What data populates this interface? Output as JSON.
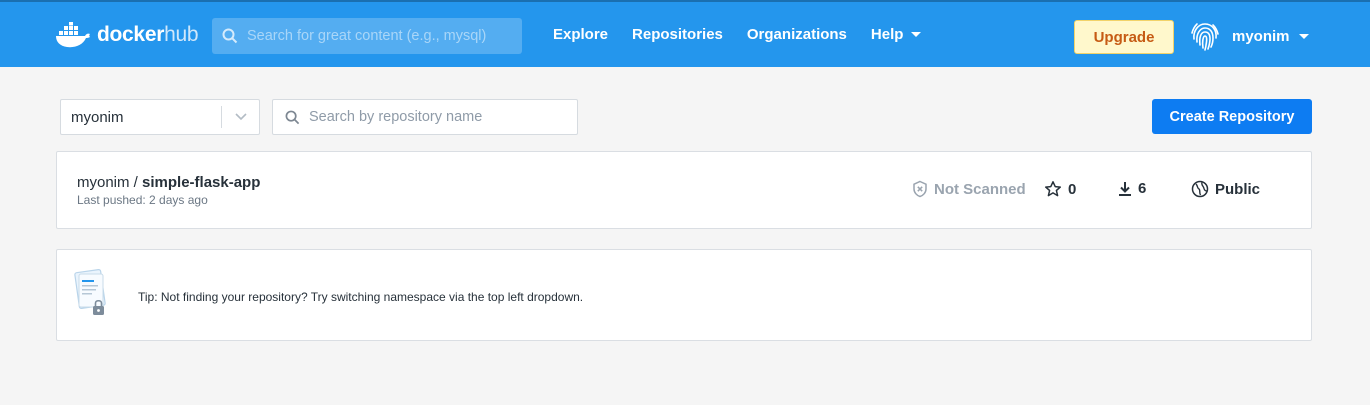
{
  "header": {
    "logo_text_bold": "docker",
    "logo_text_light": "hub",
    "search_placeholder": "Search for great content (e.g., mysql)",
    "nav": [
      {
        "label": "Explore"
      },
      {
        "label": "Repositories"
      },
      {
        "label": "Organizations"
      },
      {
        "label": "Help",
        "has_caret": true
      }
    ],
    "upgrade_label": "Upgrade",
    "username": "myonim"
  },
  "toolbar": {
    "namespace_value": "myonim",
    "repo_search_placeholder": "Search by repository name",
    "create_label": "Create Repository"
  },
  "repositories": [
    {
      "namespace": "myonim /",
      "name": "simple-flask-app",
      "last_pushed": "Last pushed: 2 days ago",
      "scan_status": "Not Scanned",
      "stars": "0",
      "pulls": "6",
      "visibility": "Public"
    }
  ],
  "tip": {
    "text": "Tip: Not finding your repository? Try switching namespace via the top left dropdown."
  },
  "colors": {
    "brand": "#2496ed",
    "primary_button": "#0d7cf2",
    "upgrade_bg": "#fff8cc",
    "upgrade_text": "#c65b14"
  },
  "icons": [
    "docker-whale-icon",
    "search-icon",
    "caret-down-icon",
    "fingerprint-avatar-icon",
    "chevron-down-icon",
    "shield-x-icon",
    "star-icon",
    "download-icon",
    "globe-lock-icon",
    "tip-illustration-icon"
  ]
}
